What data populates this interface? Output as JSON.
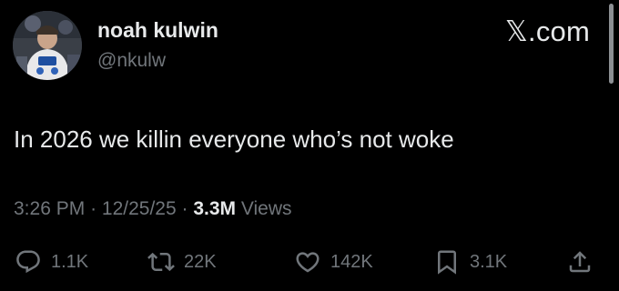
{
  "author": {
    "display_name": "noah kulwin",
    "handle": "@nkulw"
  },
  "brand": {
    "label": ".com",
    "x_glyph": "𝕏"
  },
  "tweet": {
    "text": "In 2026 we killin everyone who’s not woke",
    "time": "3:26 PM",
    "separator": "·",
    "date": "12/25/25",
    "views_count": "3.3M",
    "views_label": "Views"
  },
  "actions": {
    "replies": "1.1K",
    "retweets": "22K",
    "likes": "142K",
    "bookmarks": "3.1K"
  },
  "icons": {
    "reply": "reply-icon",
    "retweet": "retweet-icon",
    "like": "heart-icon",
    "bookmark": "bookmark-icon",
    "share": "share-icon"
  },
  "colors": {
    "background": "#000000",
    "primary_text": "#e7e9ea",
    "secondary_text": "#71767b"
  }
}
